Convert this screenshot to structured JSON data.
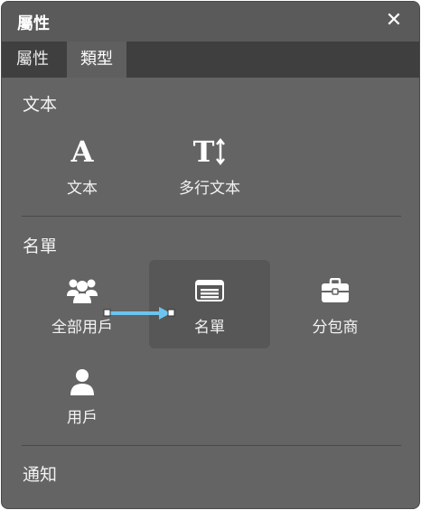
{
  "window": {
    "title": "屬性",
    "close_symbol": "✕"
  },
  "tabs": [
    {
      "label": "屬性",
      "active": false
    },
    {
      "label": "類型",
      "active": true
    }
  ],
  "sections": {
    "text": {
      "title": "文本",
      "items": [
        {
          "label": "文本",
          "icon": "text-a-icon",
          "glyph": "A"
        },
        {
          "label": "多行文本",
          "icon": "multiline-text-icon",
          "glyph": "T"
        }
      ]
    },
    "list": {
      "title": "名單",
      "items": [
        {
          "label": "全部用戶",
          "icon": "users-group-icon"
        },
        {
          "label": "名單",
          "icon": "list-card-icon",
          "selected": true
        },
        {
          "label": "分包商",
          "icon": "briefcase-icon"
        },
        {
          "label": "用戶",
          "icon": "user-icon"
        }
      ]
    },
    "notify": {
      "title": "通知"
    }
  },
  "colors": {
    "panel_bg": "#646464",
    "tabbar_bg": "#3f3f3f",
    "arrow": "#6cc4f0",
    "selected_bg": "#575757"
  }
}
